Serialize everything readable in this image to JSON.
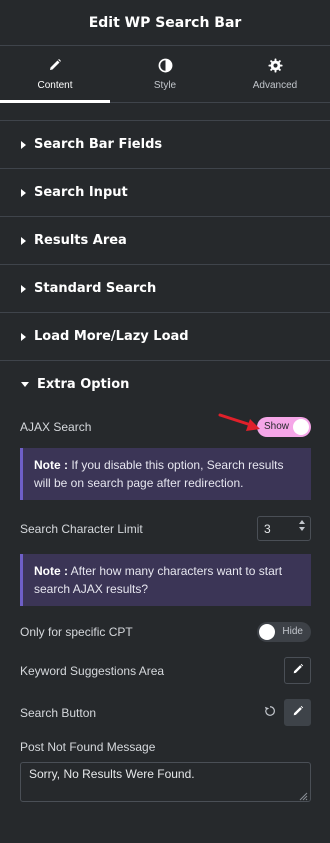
{
  "header": {
    "title": "Edit WP Search Bar"
  },
  "tabs": [
    {
      "label": "Content",
      "icon": "pencil-icon",
      "active": true
    },
    {
      "label": "Style",
      "icon": "half-circle-icon",
      "active": false
    },
    {
      "label": "Advanced",
      "icon": "gear-icon",
      "active": false
    }
  ],
  "sections": [
    {
      "label": "Search Bar Fields"
    },
    {
      "label": "Search Input"
    },
    {
      "label": "Results Area"
    },
    {
      "label": "Standard Search"
    },
    {
      "label": "Load More/Lazy Load"
    },
    {
      "label": "Extra Option"
    }
  ],
  "extra": {
    "ajax_search": {
      "label": "AJAX Search",
      "toggle": "Show"
    },
    "note1": {
      "prefix": "Note :",
      "text": " If you disable this option, Search results will be on search page after redirection."
    },
    "char_limit": {
      "label": "Search Character Limit",
      "value": "3"
    },
    "note2": {
      "prefix": "Note :",
      "text": " After how many characters want to start search AJAX results?"
    },
    "specific_cpt": {
      "label": "Only for specific CPT",
      "toggle": "Hide"
    },
    "keyword_area": {
      "label": "Keyword Suggestions Area"
    },
    "search_button": {
      "label": "Search Button"
    },
    "not_found": {
      "label": "Post Not Found Message",
      "value": "Sorry, No Results Were Found."
    }
  },
  "colors": {
    "background": "#26292c",
    "toggle_on": "#f5a6e8",
    "note_background": "#3b3556",
    "note_border": "#6e5fc7",
    "arrow": "#e0202a"
  }
}
